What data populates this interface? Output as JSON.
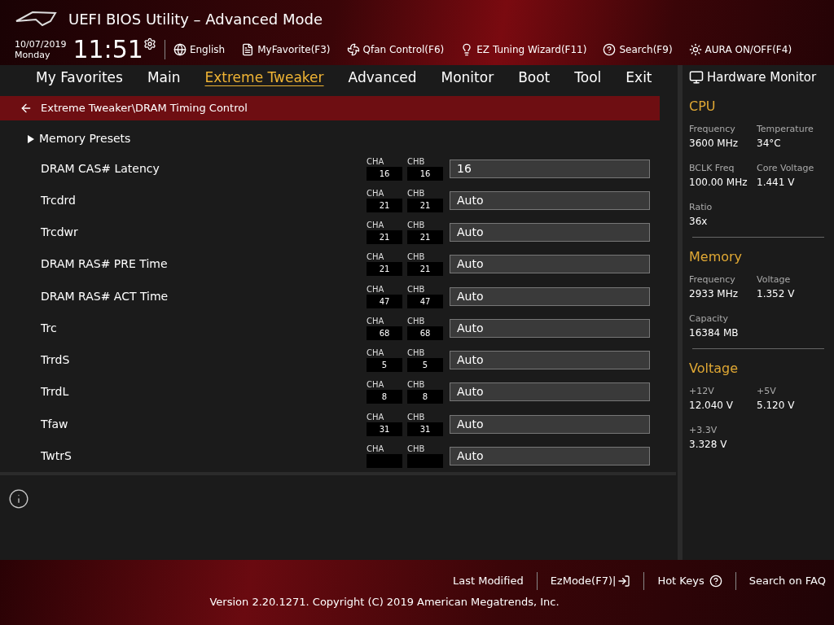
{
  "header": {
    "title": "UEFI BIOS Utility – Advanced Mode",
    "date": "10/07/2019",
    "day": "Monday",
    "time": "11:51",
    "tools": [
      {
        "kind": "language",
        "label": "English"
      },
      {
        "kind": "favorite",
        "label": "MyFavorite(F3)"
      },
      {
        "kind": "fan",
        "label": "Qfan Control(F6)"
      },
      {
        "kind": "wizard",
        "label": "EZ Tuning Wizard(F11)"
      },
      {
        "kind": "search",
        "label": "Search(F9)"
      },
      {
        "kind": "aura",
        "label": "AURA ON/OFF(F4)"
      }
    ]
  },
  "tabs": [
    {
      "label": "My Favorites",
      "selected": false
    },
    {
      "label": "Main",
      "selected": false
    },
    {
      "label": "Extreme Tweaker",
      "selected": true
    },
    {
      "label": "Advanced",
      "selected": false
    },
    {
      "label": "Monitor",
      "selected": false
    },
    {
      "label": "Boot",
      "selected": false
    },
    {
      "label": "Tool",
      "selected": false
    },
    {
      "label": "Exit",
      "selected": false
    }
  ],
  "breadcrumb": "Extreme Tweaker\\DRAM Timing Control",
  "submenu": "Memory Presets",
  "settings": [
    {
      "name": "DRAM CAS# Latency",
      "cha_label": "CHA",
      "cha": "16",
      "chb_label": "CHB",
      "chb": "16",
      "value": "16"
    },
    {
      "name": "Trcdrd",
      "cha_label": "CHA",
      "cha": "21",
      "chb_label": "CHB",
      "chb": "21",
      "value": "Auto"
    },
    {
      "name": "Trcdwr",
      "cha_label": "CHA",
      "cha": "21",
      "chb_label": "CHB",
      "chb": "21",
      "value": "Auto"
    },
    {
      "name": "DRAM RAS# PRE Time",
      "cha_label": "CHA",
      "cha": "21",
      "chb_label": "CHB",
      "chb": "21",
      "value": "Auto"
    },
    {
      "name": "DRAM RAS# ACT Time",
      "cha_label": "CHA",
      "cha": "47",
      "chb_label": "CHB",
      "chb": "47",
      "value": "Auto"
    },
    {
      "name": "Trc",
      "cha_label": "CHA",
      "cha": "68",
      "chb_label": "CHB",
      "chb": "68",
      "value": "Auto"
    },
    {
      "name": "TrrdS",
      "cha_label": "CHA",
      "cha": "5",
      "chb_label": "CHB",
      "chb": "5",
      "value": "Auto"
    },
    {
      "name": "TrrdL",
      "cha_label": "CHA",
      "cha": "8",
      "chb_label": "CHB",
      "chb": "8",
      "value": "Auto"
    },
    {
      "name": "Tfaw",
      "cha_label": "CHA",
      "cha": "31",
      "chb_label": "CHB",
      "chb": "31",
      "value": "Auto"
    },
    {
      "name": "TwtrS",
      "cha_label": "CHA",
      "chb_label": "CHB",
      "value": "Auto"
    }
  ],
  "hardware_monitor": {
    "title": "Hardware Monitor",
    "sections": [
      {
        "title": "CPU",
        "items": [
          {
            "label": "Frequency",
            "value": "3600 MHz"
          },
          {
            "label": "Temperature",
            "value": "34°C"
          },
          {
            "label": "BCLK Freq",
            "value": "100.00 MHz"
          },
          {
            "label": "Core Voltage",
            "value": "1.441 V"
          },
          {
            "label": "Ratio",
            "value": "36x"
          }
        ]
      },
      {
        "title": "Memory",
        "items": [
          {
            "label": "Frequency",
            "value": "2933 MHz"
          },
          {
            "label": "Voltage",
            "value": "1.352 V"
          },
          {
            "label": "Capacity",
            "value": "16384 MB"
          }
        ]
      },
      {
        "title": "Voltage",
        "items": [
          {
            "label": "+12V",
            "value": "12.040 V"
          },
          {
            "label": "+5V",
            "value": "5.120 V"
          },
          {
            "label": "+3.3V",
            "value": "3.328 V"
          }
        ]
      }
    ]
  },
  "footer": {
    "links": [
      {
        "kind": "plain",
        "label": "Last Modified"
      },
      {
        "kind": "ezmode",
        "label": "EzMode(F7)|"
      },
      {
        "kind": "hotkeys",
        "label": "Hot Keys"
      },
      {
        "kind": "plain",
        "label": "Search on FAQ"
      }
    ],
    "copyright": "Version 2.20.1271. Copyright (C) 2019 American Megatrends, Inc."
  }
}
